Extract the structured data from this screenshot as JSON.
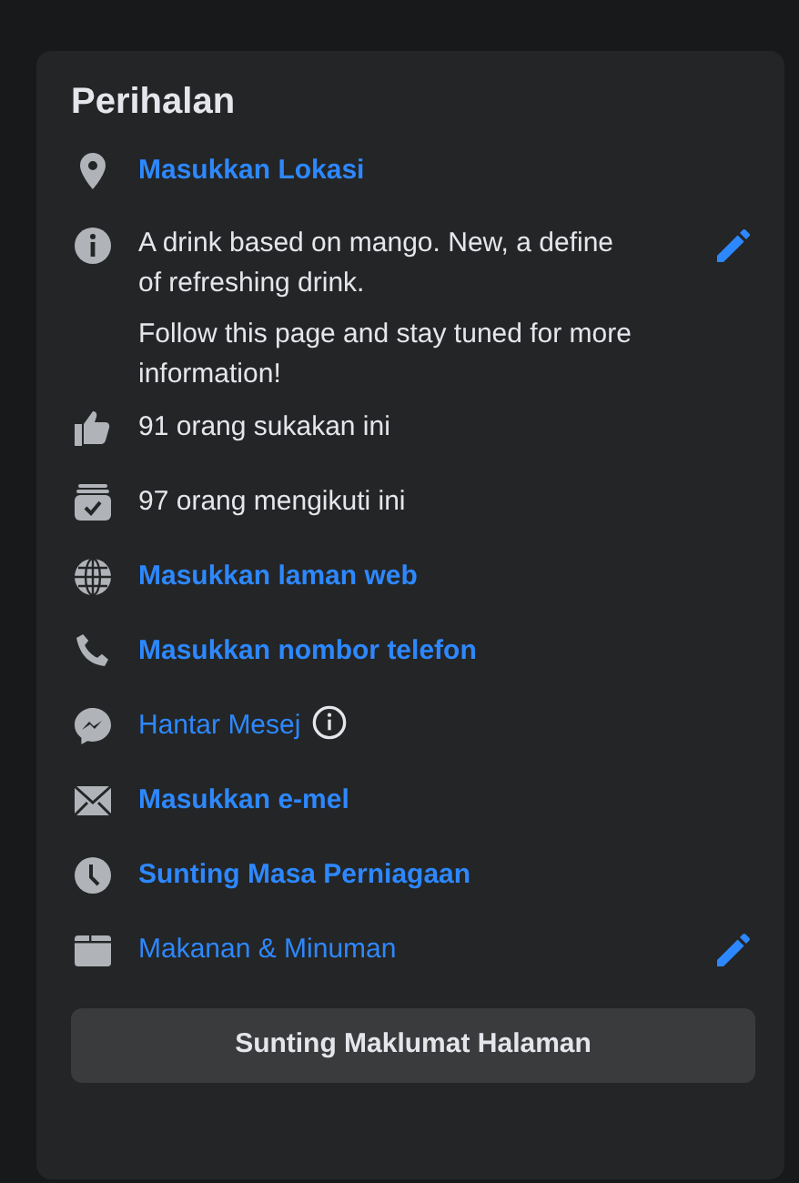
{
  "title": "Perihalan",
  "items": [
    {
      "kind": "action",
      "text": "Masukkan Lokasi",
      "editable": false,
      "info": false
    },
    {
      "kind": "description",
      "paragraphs": [
        "A drink based on mango. New, a define of refreshing drink.",
        "Follow this page and stay tuned for more information!"
      ],
      "editable": true,
      "info": false
    },
    {
      "kind": "text",
      "text": "91 orang sukakan ini",
      "editable": false,
      "info": false
    },
    {
      "kind": "text",
      "text": "97 orang mengikuti ini",
      "editable": false,
      "info": false
    },
    {
      "kind": "action",
      "text": "Masukkan laman web",
      "editable": false,
      "info": false
    },
    {
      "kind": "action",
      "text": "Masukkan nombor telefon",
      "editable": false,
      "info": false
    },
    {
      "kind": "link",
      "text": "Hantar Mesej",
      "editable": false,
      "info": true
    },
    {
      "kind": "action",
      "text": "Masukkan e-mel",
      "editable": false,
      "info": false
    },
    {
      "kind": "action",
      "text": "Sunting Masa Perniagaan",
      "editable": false,
      "info": false
    },
    {
      "kind": "link",
      "text": "Makanan & Minuman",
      "editable": true,
      "info": false
    }
  ],
  "button": "Sunting Maklumat Halaman"
}
